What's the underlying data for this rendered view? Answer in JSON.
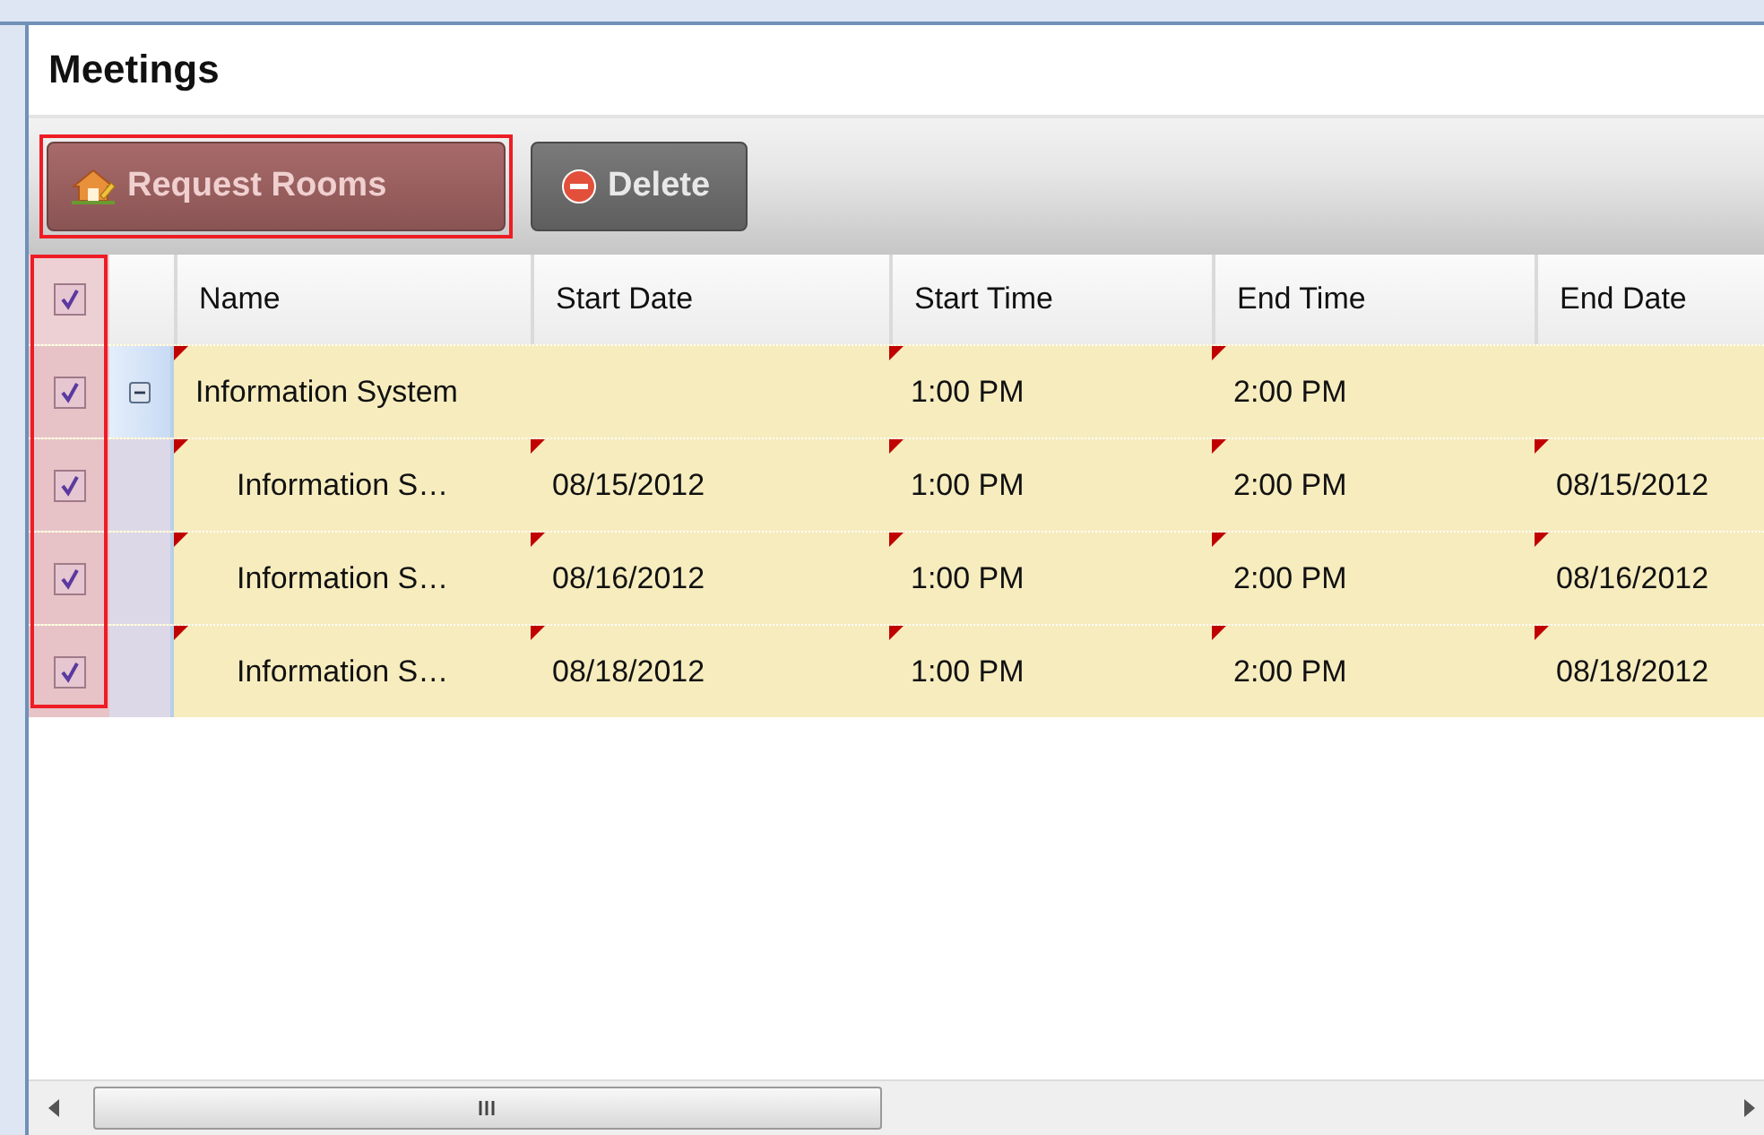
{
  "panel": {
    "title": "Meetings"
  },
  "toolbar": [
    {
      "label": "Request Rooms",
      "kind": "request",
      "highlighted": true
    },
    {
      "label": "Delete",
      "kind": "delete",
      "highlighted": false
    }
  ],
  "checkbox_column": {
    "highlighted": true
  },
  "table": {
    "all_checked": true,
    "columns": [
      "Name",
      "Start Date",
      "Start Time",
      "End Time",
      "End Date"
    ],
    "rows": [
      {
        "checked": true,
        "expanded": true,
        "cells": [
          {
            "text": "Information System",
            "modified": true
          },
          null,
          {
            "text": "1:00 PM",
            "modified": true
          },
          {
            "text": "2:00 PM",
            "modified": true
          },
          null
        ],
        "children": [
          {
            "checked": true,
            "cells": [
              {
                "text": "Information S…",
                "modified": true
              },
              {
                "text": "08/15/2012",
                "modified": true
              },
              {
                "text": "1:00 PM",
                "modified": true
              },
              {
                "text": "2:00 PM",
                "modified": true
              },
              {
                "text": "08/15/2012",
                "modified": true
              }
            ]
          },
          {
            "checked": true,
            "cells": [
              {
                "text": "Information S…",
                "modified": true
              },
              {
                "text": "08/16/2012",
                "modified": true
              },
              {
                "text": "1:00 PM",
                "modified": true
              },
              {
                "text": "2:00 PM",
                "modified": true
              },
              {
                "text": "08/16/2012",
                "modified": true
              }
            ]
          },
          {
            "checked": true,
            "cells": [
              {
                "text": "Information S…",
                "modified": true
              },
              {
                "text": "08/18/2012",
                "modified": true
              },
              {
                "text": "1:00 PM",
                "modified": true
              },
              {
                "text": "2:00 PM",
                "modified": true
              },
              {
                "text": "08/18/2012",
                "modified": true
              }
            ]
          }
        ]
      }
    ]
  }
}
